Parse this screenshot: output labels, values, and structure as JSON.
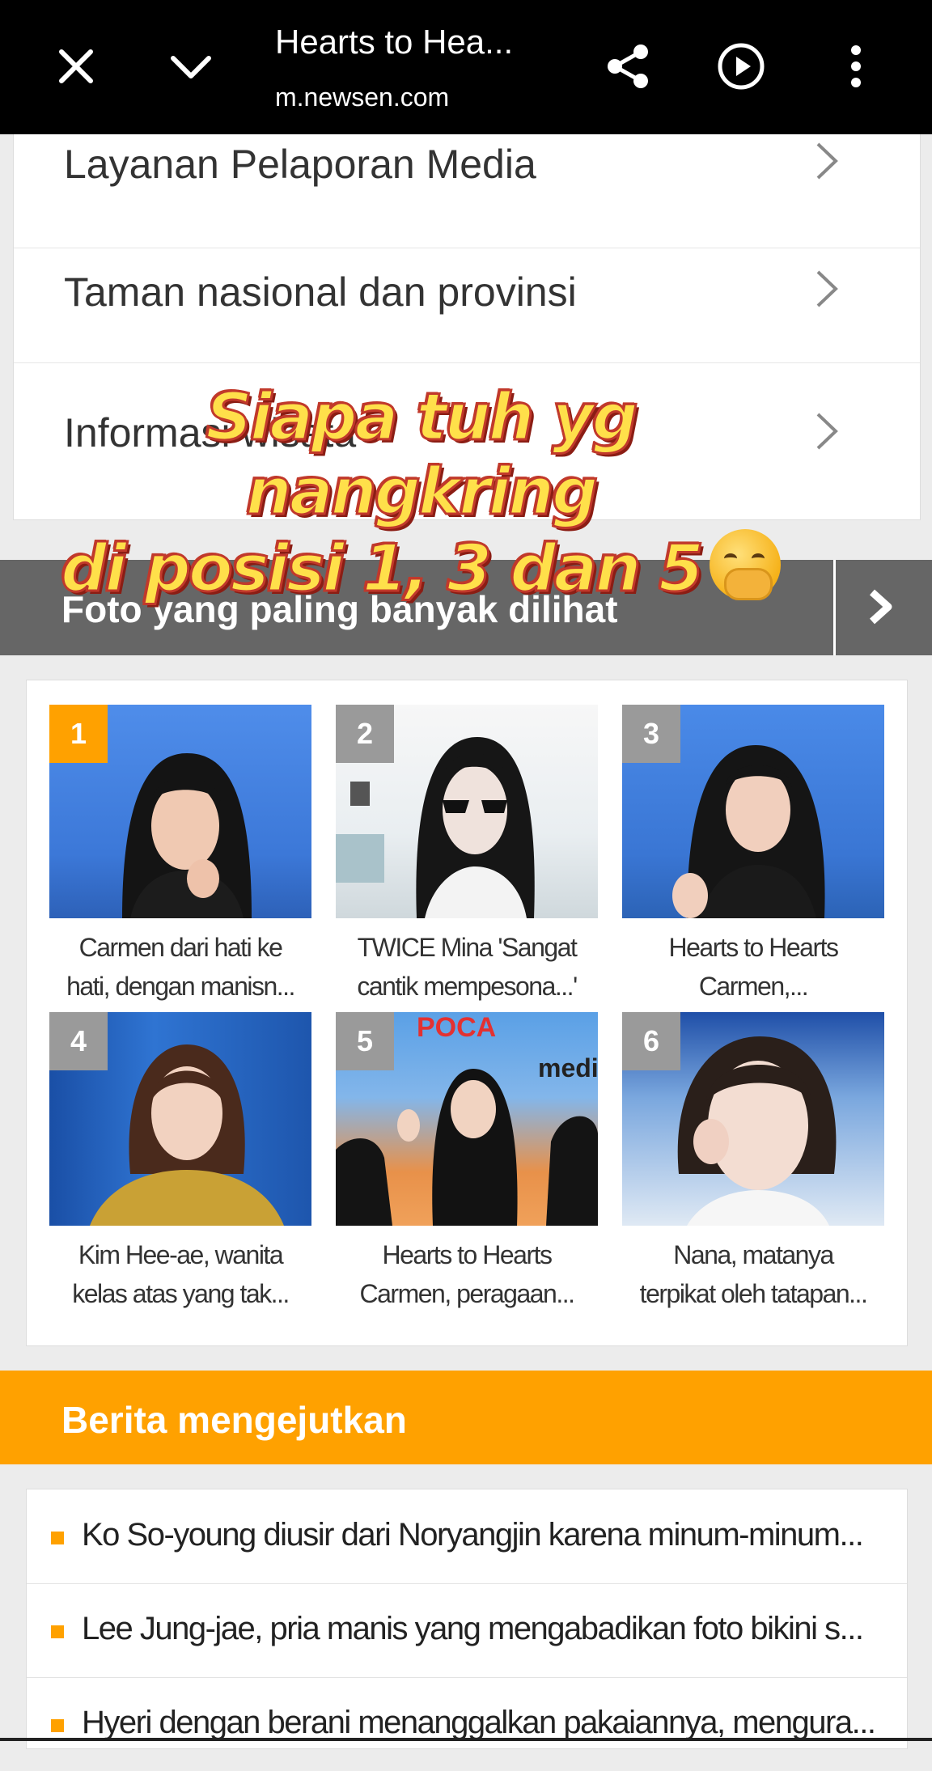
{
  "browser": {
    "tab_title": "Hearts to Hea...",
    "url": "m.newsen.com",
    "icons": [
      "close-icon",
      "chevron-down-icon",
      "share-icon",
      "play-icon",
      "more-vert-icon"
    ]
  },
  "menu": {
    "items": [
      {
        "label": "Layanan Pelaporan Media"
      },
      {
        "label": "Taman nasional dan provinsi"
      },
      {
        "label": "Informasi wisata"
      }
    ]
  },
  "overlay": {
    "line1": "Siapa tuh yg nangkring",
    "line2": "di posisi 1, 3 dan 5",
    "emoji": "face-with-hand-over-mouth"
  },
  "photos_section": {
    "title": "Foto yang paling banyak dilihat",
    "items": [
      {
        "rank": "1",
        "caption_l1": "Carmen dari hati ke",
        "caption_l2": "hati, dengan manisn...",
        "highlight": true
      },
      {
        "rank": "2",
        "caption_l1": "TWICE Mina 'Sangat",
        "caption_l2": "cantik mempesona...'",
        "highlight": false
      },
      {
        "rank": "3",
        "caption_l1": "Hearts to Hearts",
        "caption_l2": "Carmen,...",
        "highlight": false
      },
      {
        "rank": "4",
        "caption_l1": "Kim Hee-ae, wanita",
        "caption_l2": "kelas atas yang tak...",
        "highlight": false
      },
      {
        "rank": "5",
        "caption_l1": "Hearts to Hearts",
        "caption_l2": "Carmen, peragaan...",
        "highlight": false
      },
      {
        "rank": "6",
        "caption_l1": "Nana, matanya",
        "caption_l2": "terpikat oleh tatapan...",
        "highlight": false
      }
    ],
    "poster_text": "POCA",
    "poster_text2": "medi"
  },
  "news_section": {
    "title": "Berita mengejutkan",
    "items": [
      {
        "text": "Ko So-young diusir dari Noryangjin karena minum-minum..."
      },
      {
        "text": "Lee Jung-jae, pria manis yang mengabadikan foto bikini s..."
      },
      {
        "text": "Hyeri dengan berani menanggalkan pakaiannya, mengura..."
      }
    ]
  },
  "colors": {
    "rank_highlight": "#ffa100",
    "rank_default": "#9a9a9a",
    "section_gray": "#666666",
    "section_orange": "#ffa100"
  }
}
